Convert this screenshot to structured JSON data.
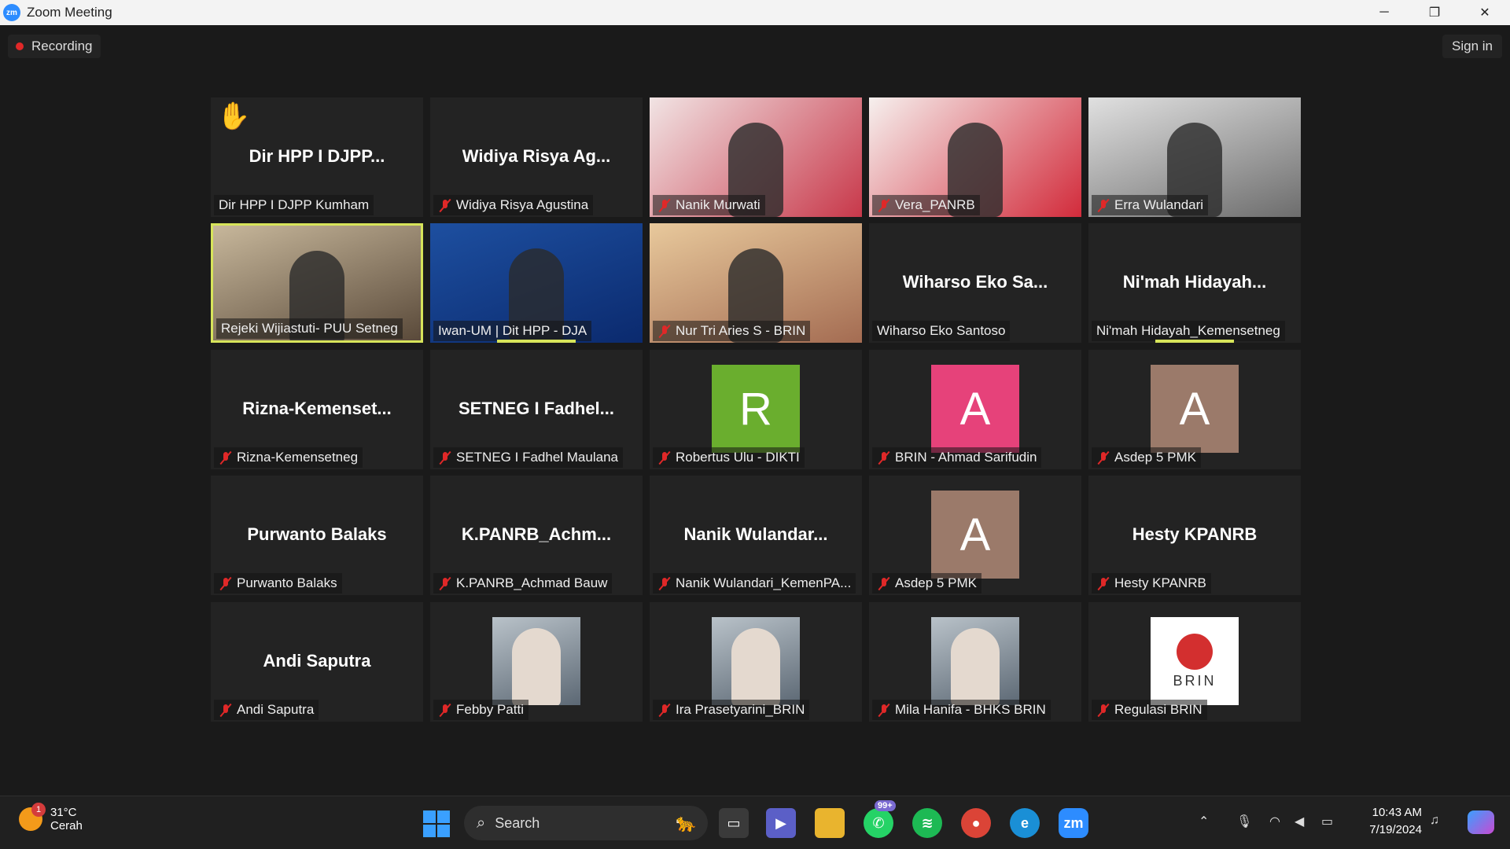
{
  "window": {
    "title": "Zoom Meeting",
    "app_icon": "zm"
  },
  "toolbar": {
    "recording": "Recording",
    "sign_in": "Sign in"
  },
  "tiles": [
    {
      "name": "Dir HPP I DJPP Kumham",
      "big": "Dir HPP I DJPP...",
      "muted": false,
      "hand": true
    },
    {
      "name": "Widiya Risya Agustina",
      "big": "Widiya Risya Ag...",
      "muted": true
    },
    {
      "name": "Nanik Murwati",
      "muted": true,
      "video": true
    },
    {
      "name": "Vera_PANRB",
      "muted": true,
      "video": true
    },
    {
      "name": "Erra Wulandari",
      "muted": true,
      "video": true
    },
    {
      "name": "Rejeki Wijiastuti- PUU Setneg",
      "muted": false,
      "video": true,
      "active": true
    },
    {
      "name": "Iwan-UM | Dit HPP - DJA",
      "muted": false,
      "video": true
    },
    {
      "name": "Nur Tri Aries S - BRIN",
      "muted": true,
      "video": true
    },
    {
      "name": "Wiharso Eko Santoso",
      "big": "Wiharso Eko Sa...",
      "muted": false
    },
    {
      "name": "Ni'mah Hidayah_Kemensetneg",
      "big": "Ni'mah Hidayah...",
      "muted": false
    },
    {
      "name": "Rizna-Kemensetneg",
      "big": "Rizna-Kemenset...",
      "muted": true
    },
    {
      "name": "SETNEG I Fadhel Maulana",
      "big": "SETNEG I Fadhel...",
      "muted": true
    },
    {
      "name": "Robertus Ulu - DIKTI",
      "avatar": "R",
      "muted": true
    },
    {
      "name": "BRIN - Ahmad Sarifudin",
      "avatar": "A",
      "muted": true
    },
    {
      "name": "Asdep 5 PMK",
      "avatar": "A",
      "muted": true
    },
    {
      "name": "Purwanto Balaks",
      "big": "Purwanto Balaks",
      "muted": true
    },
    {
      "name": "K.PANRB_Achmad Bauw",
      "big": "K.PANRB_Achm...",
      "muted": true
    },
    {
      "name": "Nanik Wulandari_KemenPA...",
      "big": "Nanik Wulandar...",
      "muted": true
    },
    {
      "name": "Asdep 5 PMK",
      "avatar": "A",
      "muted": true
    },
    {
      "name": "Hesty KPANRB",
      "big": "Hesty KPANRB",
      "muted": true
    },
    {
      "name": "Andi Saputra",
      "big": "Andi Saputra",
      "muted": true
    },
    {
      "name": "Febby Patti",
      "muted": true,
      "photo": true
    },
    {
      "name": "Ira Prasetyarini_BRIN",
      "muted": true,
      "photo": true
    },
    {
      "name": "Mila Hanifa - BHKS BRIN",
      "muted": true,
      "photo": true
    },
    {
      "name": "Regulasi BRIN",
      "muted": true,
      "photo": true,
      "logo": "BRIN"
    }
  ],
  "colors": {
    "avatar_green": "#6aae2e",
    "avatar_pink": "#e6427a",
    "avatar_brown": "#9b7a6a",
    "speaker": "#d7e45a",
    "muted": "#e02828"
  },
  "taskbar": {
    "weather_temp": "31°C",
    "weather_desc": "Cerah",
    "weather_badge": "1",
    "search_placeholder": "Search",
    "whatsapp_badge": "99+",
    "time": "10:43 AM",
    "date": "7/19/2024"
  }
}
